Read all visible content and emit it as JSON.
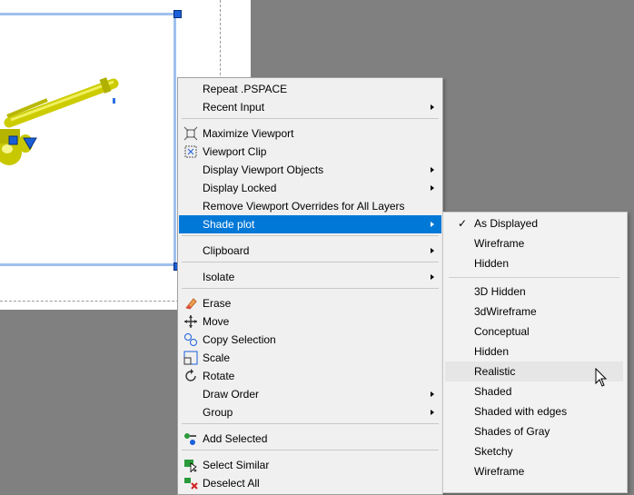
{
  "menu": {
    "items": [
      {
        "id": "repeat",
        "label": "Repeat .PSPACE"
      },
      {
        "id": "recent",
        "label": "Recent Input"
      },
      {
        "id": "maximize",
        "label": "Maximize Viewport"
      },
      {
        "id": "clip",
        "label": "Viewport Clip"
      },
      {
        "id": "display_objects",
        "label": "Display Viewport Objects"
      },
      {
        "id": "display_locked",
        "label": "Display Locked"
      },
      {
        "id": "remove_overrides",
        "label": "Remove Viewport Overrides for All Layers"
      },
      {
        "id": "shade_plot",
        "label": "Shade plot"
      },
      {
        "id": "clipboard",
        "label": "Clipboard"
      },
      {
        "id": "isolate",
        "label": "Isolate"
      },
      {
        "id": "erase",
        "label": "Erase"
      },
      {
        "id": "move",
        "label": "Move"
      },
      {
        "id": "copy_selection",
        "label": "Copy Selection"
      },
      {
        "id": "scale",
        "label": "Scale"
      },
      {
        "id": "rotate",
        "label": "Rotate"
      },
      {
        "id": "draw_order",
        "label": "Draw Order"
      },
      {
        "id": "group",
        "label": "Group"
      },
      {
        "id": "add_selected",
        "label": "Add Selected"
      },
      {
        "id": "select_similar",
        "label": "Select Similar"
      },
      {
        "id": "deselect_all",
        "label": "Deselect All"
      }
    ]
  },
  "submenu": {
    "top": [
      "As Displayed",
      "Wireframe",
      "Hidden"
    ],
    "styles": [
      "3D Hidden",
      "3dWireframe",
      "Conceptual",
      "Hidden",
      "Realistic",
      "Shaded",
      "Shaded with edges",
      "Shades of Gray",
      "Sketchy",
      "Wireframe"
    ],
    "checked": "As Displayed",
    "hovered": "Realistic"
  },
  "colors": {
    "highlight": "#0078d7",
    "model": "#d8d800",
    "grip": "#1a5fd8",
    "background": "#808080"
  }
}
